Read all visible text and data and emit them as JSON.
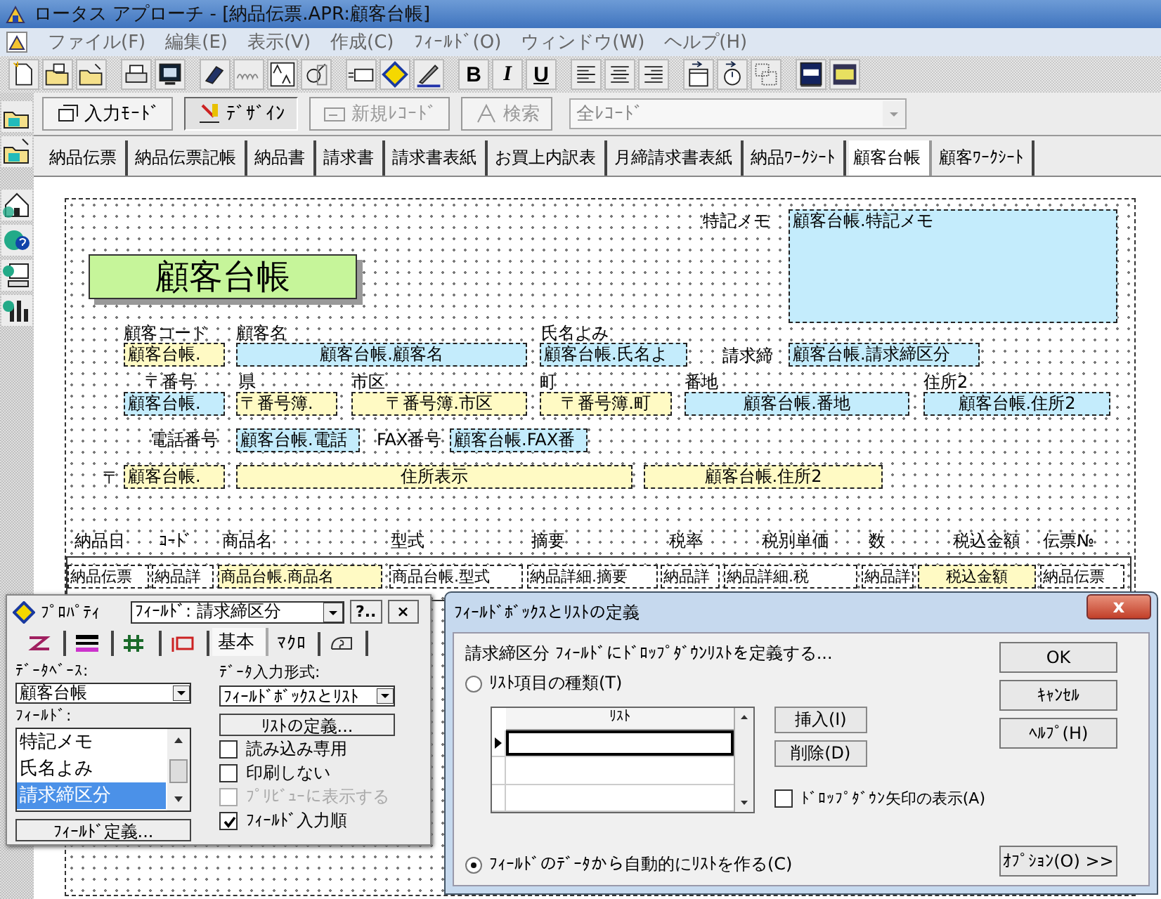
{
  "window": {
    "title": "ロータス アプローチ - [納品伝票.APR:顧客台帳]"
  },
  "menu": [
    "ファイル(F)",
    "編集(E)",
    "表示(V)",
    "作成(C)",
    "ﾌｨｰﾙﾄﾞ(O)",
    "ウィンドウ(W)",
    "ヘルプ(H)"
  ],
  "format_buttons": [
    {
      "label": "B",
      "kind": "bold"
    },
    {
      "label": "I",
      "kind": "italic"
    },
    {
      "label": "U",
      "kind": "underline"
    }
  ],
  "mode_bar": {
    "buttons": [
      {
        "label": "入力ﾓｰﾄﾞ",
        "selected": false,
        "disabled": false
      },
      {
        "label": "ﾃﾞｻﾞｲﾝ",
        "selected": true,
        "disabled": false
      },
      {
        "label": "新規ﾚｺｰﾄﾞ",
        "selected": false,
        "disabled": true
      },
      {
        "label": "検索",
        "selected": false,
        "disabled": true
      }
    ],
    "record_filter": "全ﾚｺｰﾄﾞ"
  },
  "tabs": [
    {
      "label": "納品伝票",
      "selected": false
    },
    {
      "label": "納品伝票記帳",
      "selected": false
    },
    {
      "label": "納品書",
      "selected": false
    },
    {
      "label": "請求書",
      "selected": false
    },
    {
      "label": "請求書表紙",
      "selected": false
    },
    {
      "label": "お買上内訳表",
      "selected": false
    },
    {
      "label": "月締請求書表紙",
      "selected": false
    },
    {
      "label": "納品ﾜｰｸｼｰﾄ",
      "selected": false
    },
    {
      "label": "顧客台帳",
      "selected": true
    },
    {
      "label": "顧客ﾜｰｸｼｰﾄ",
      "selected": false
    }
  ],
  "form": {
    "items": [
      {
        "kind": "label",
        "text": "特記メモ"
      },
      {
        "kind": "field",
        "text": "顧客台帳.特記メモ",
        "color": "#c4ecfc"
      },
      {
        "kind": "title",
        "text": "顧客台帳"
      },
      {
        "kind": "label",
        "text": "顧客コード"
      },
      {
        "kind": "label",
        "text": "顧客名"
      },
      {
        "kind": "label",
        "text": "氏名よみ"
      },
      {
        "kind": "field",
        "text": "顧客台帳.",
        "color": "#fffac4"
      },
      {
        "kind": "field",
        "text": "顧客台帳.顧客名",
        "color": "#c4ecfc"
      },
      {
        "kind": "field",
        "text": "顧客台帳.氏名よ",
        "color": "#c4ecfc"
      },
      {
        "kind": "label",
        "text": "請求締"
      },
      {
        "kind": "field",
        "text": "顧客台帳.請求締区分",
        "color": "#c4ecfc"
      },
      {
        "kind": "label",
        "text": "〒番号"
      },
      {
        "kind": "label",
        "text": "県"
      },
      {
        "kind": "label",
        "text": "市区"
      },
      {
        "kind": "label",
        "text": "町"
      },
      {
        "kind": "label",
        "text": "番地"
      },
      {
        "kind": "label",
        "text": "住所2"
      },
      {
        "kind": "field",
        "text": "顧客台帳.",
        "color": "#c4ecfc"
      },
      {
        "kind": "field",
        "text": "〒番号簿.",
        "color": "#fffac4"
      },
      {
        "kind": "field",
        "text": "〒番号簿.市区",
        "color": "#fffac4"
      },
      {
        "kind": "field",
        "text": "〒番号簿.町",
        "color": "#fffac4"
      },
      {
        "kind": "field",
        "text": "顧客台帳.番地",
        "color": "#c4ecfc"
      },
      {
        "kind": "field",
        "text": "顧客台帳.住所2",
        "color": "#c4ecfc"
      },
      {
        "kind": "label",
        "text": "電話番号"
      },
      {
        "kind": "field",
        "text": "顧客台帳.電話",
        "color": "#c4ecfc"
      },
      {
        "kind": "label",
        "text": "FAX番号"
      },
      {
        "kind": "field",
        "text": "顧客台帳.FAX番",
        "color": "#c4ecfc"
      },
      {
        "kind": "label",
        "text": "〒"
      },
      {
        "kind": "field",
        "text": "顧客台帳.",
        "color": "#fffac4"
      },
      {
        "kind": "field",
        "text": "住所表示",
        "color": "#fffac4"
      },
      {
        "kind": "field",
        "text": "顧客台帳.住所2",
        "color": "#fffac4"
      }
    ],
    "table": {
      "headers": [
        "納品日",
        "ｺｰﾄﾞ",
        "商品名",
        "型式",
        "摘要",
        "税率",
        "税別単価",
        "数",
        "税込金額",
        "伝票№"
      ],
      "cells": [
        {
          "text": "納品伝票",
          "color": "#ffffff"
        },
        {
          "text": "納品詳",
          "color": "#ffffff"
        },
        {
          "text": "商品台帳.商品名",
          "color": "#fffac4"
        },
        {
          "text": "商品台帳.型式",
          "color": "#ffffff"
        },
        {
          "text": "納品詳細.摘要",
          "color": "#ffffff"
        },
        {
          "text": "納品詳",
          "color": "#ffffff"
        },
        {
          "text": "納品詳細.税",
          "color": "#ffffff"
        },
        {
          "text": "納品詳",
          "color": "#ffffff"
        },
        {
          "text": "税込金額",
          "color": "#fffac4"
        },
        {
          "text": "納品伝票",
          "color": "#ffffff"
        }
      ]
    }
  },
  "properties": {
    "title": "ﾌﾟﾛﾊﾟﾃｨ",
    "selector": "ﾌｨｰﾙﾄﾞ: 請求締区分",
    "help_button": "?..",
    "close_button": "×",
    "tabs": [
      {
        "kind": "icon",
        "selected": false
      },
      {
        "kind": "icon",
        "selected": false
      },
      {
        "kind": "icon",
        "selected": false
      },
      {
        "kind": "icon",
        "selected": false
      },
      {
        "kind": "text",
        "label": "基本",
        "selected": true
      },
      {
        "kind": "text",
        "label": "ﾏｸﾛ",
        "selected": false
      },
      {
        "kind": "icon",
        "selected": false
      }
    ],
    "database_label": "ﾃﾞｰﾀﾍﾞｰｽ:",
    "database": "顧客台帳",
    "field_label": "ﾌｨｰﾙﾄﾞ:",
    "fields": [
      {
        "label": "特記メモ",
        "selected": false
      },
      {
        "label": "氏名よみ",
        "selected": false
      },
      {
        "label": "請求締区分",
        "selected": true
      }
    ],
    "field_def_button": "ﾌｨｰﾙﾄﾞ定義...",
    "input_format_label": "ﾃﾞｰﾀ入力形式:",
    "input_format": "ﾌｨｰﾙﾄﾞﾎﾞｯｸｽとﾘｽﾄ",
    "list_def_button": "ﾘｽﾄの定義...",
    "options": [
      {
        "label": "読み込み専用",
        "checked": false,
        "disabled": false
      },
      {
        "label": "印刷しない",
        "checked": false,
        "disabled": false
      },
      {
        "label": "ﾌﾟﾘﾋﾞｭｰに表示する",
        "checked": false,
        "disabled": true
      },
      {
        "label": "ﾌｨｰﾙﾄﾞ入力順",
        "checked": true,
        "disabled": false
      }
    ]
  },
  "dialog": {
    "title": "ﾌｨｰﾙﾄﾞﾎﾞｯｸｽとﾘｽﾄの定義",
    "close_button": "x",
    "prompt": "請求締区分 ﾌｨｰﾙﾄﾞにﾄﾞﾛｯﾌﾟﾀﾞｳﾝﾘｽﾄを定義する...",
    "radios": [
      {
        "label": "ﾘｽﾄ項目の種類(T)",
        "selected": false
      },
      {
        "label": "ﾌｨｰﾙﾄﾞのﾃﾞｰﾀから自動的にﾘｽﾄを作る(C)",
        "selected": true
      }
    ],
    "grid": {
      "header": "ﾘｽﾄ",
      "rows": [
        {
          "selected": true
        },
        {
          "selected": false
        },
        {
          "selected": false
        }
      ]
    },
    "insert_button": "挿入(I)",
    "delete_button": "削除(D)",
    "arrow_option": {
      "label": "ﾄﾞﾛｯﾌﾟﾀﾞｳﾝ矢印の表示(A)",
      "checked": false
    },
    "buttons": [
      "OK",
      "ｷｬﾝｾﾙ",
      "ﾍﾙﾌﾟ(H)"
    ],
    "options_button": "ｵﾌﾟｼｮﾝ(O) >>"
  }
}
